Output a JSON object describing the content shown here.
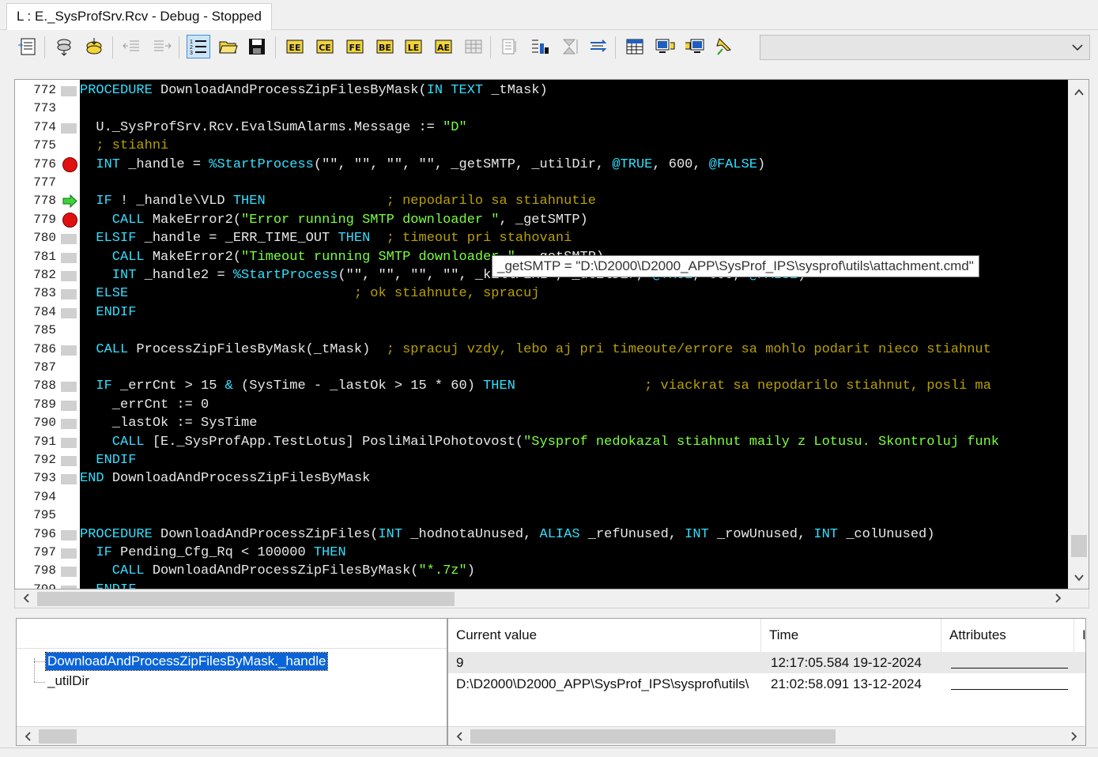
{
  "window": {
    "tab_title": "L : E._SysProfSrv.Rcv - Debug - Stopped"
  },
  "toolbar": {
    "buttons": [
      {
        "icon": "list-window-icon"
      },
      {
        "icon": "save-stack-icon"
      },
      {
        "icon": "load-stack-icon"
      },
      {
        "icon": "indent-left-icon"
      },
      {
        "icon": "indent-right-icon"
      },
      {
        "icon": "numbered-list-icon"
      },
      {
        "icon": "open-folder-icon"
      },
      {
        "icon": "save-disk-icon"
      },
      {
        "icon": "ee-icon"
      },
      {
        "icon": "ce-icon"
      },
      {
        "icon": "fe-icon"
      },
      {
        "icon": "be-icon"
      },
      {
        "icon": "le-icon"
      },
      {
        "icon": "ae-icon"
      },
      {
        "icon": "grid-disabled-icon"
      },
      {
        "icon": "step-over-icon"
      },
      {
        "icon": "step-into-icon"
      },
      {
        "icon": "sort-icon"
      },
      {
        "icon": "wrap-icon"
      },
      {
        "icon": "calendar-icon"
      },
      {
        "icon": "monitor-export-icon"
      },
      {
        "icon": "monitor-import-icon"
      },
      {
        "icon": "pin-icon"
      }
    ],
    "combo_value": ""
  },
  "editor": {
    "lines": [
      {
        "num": "772",
        "marker": "gray",
        "segs": [
          [
            "k",
            "PROCEDURE "
          ],
          [
            "n",
            "DownloadAndProcessZipFilesByMask("
          ],
          [
            "k",
            "IN "
          ],
          [
            "k",
            "TEXT "
          ],
          [
            "n",
            "_tMask)"
          ]
        ]
      },
      {
        "num": "773",
        "marker": "none",
        "segs": []
      },
      {
        "num": "774",
        "marker": "gray",
        "segs": [
          [
            "n",
            "  U._SysProfSrv.Rcv.EvalSumAlarms.Message := "
          ],
          [
            "s",
            "\"D\""
          ]
        ]
      },
      {
        "num": "775",
        "marker": "none",
        "segs": [
          [
            "c",
            "  ; stiahni"
          ]
        ]
      },
      {
        "num": "776",
        "marker": "breakpoint",
        "segs": [
          [
            "k",
            "  INT "
          ],
          [
            "n",
            "_handle = "
          ],
          [
            "k",
            "%StartProcess"
          ],
          [
            "n",
            "(\"\", \"\", \"\", \"\", _getSMTP, _utilDir, "
          ],
          [
            "k",
            "@TRUE"
          ],
          [
            "n",
            ", 600, "
          ],
          [
            "k",
            "@FALSE"
          ],
          [
            "n",
            ")"
          ]
        ]
      },
      {
        "num": "777",
        "marker": "none",
        "segs": []
      },
      {
        "num": "778",
        "marker": "arrow",
        "segs": [
          [
            "k",
            "  IF "
          ],
          [
            "n",
            "! _handle\\VLD "
          ],
          [
            "k",
            "THEN"
          ],
          [
            "n",
            "               "
          ],
          [
            "c",
            "; nepodarilo sa stiahnutie"
          ]
        ]
      },
      {
        "num": "779",
        "marker": "breakpoint",
        "segs": [
          [
            "k",
            "    CALL "
          ],
          [
            "n",
            "MakeError2("
          ],
          [
            "s",
            "\"Error running SMTP downloader \""
          ],
          [
            "n",
            ", _getSMTP)"
          ]
        ]
      },
      {
        "num": "780",
        "marker": "gray",
        "segs": [
          [
            "k",
            "  ELSIF "
          ],
          [
            "n",
            "_handle = _ERR_TIME_OUT "
          ],
          [
            "k",
            "THEN"
          ],
          [
            "n",
            "  "
          ],
          [
            "c",
            "; timeout pri stahovani"
          ]
        ]
      },
      {
        "num": "781",
        "marker": "gray",
        "segs": [
          [
            "k",
            "    CALL "
          ],
          [
            "n",
            "MakeError2("
          ],
          [
            "s",
            "\"Timeout running SMTP downloader \""
          ],
          [
            "n",
            ", _getSMTP)"
          ]
        ]
      },
      {
        "num": "782",
        "marker": "gray",
        "segs": [
          [
            "k",
            "    INT "
          ],
          [
            "n",
            "_handle2 = "
          ],
          [
            "k",
            "%StartProcess"
          ],
          [
            "n",
            "(\"\", \"\", \"\", \"\", _killPERL , _utilDir, "
          ],
          [
            "k",
            "@TRUE"
          ],
          [
            "n",
            ", 600, "
          ],
          [
            "k",
            "@FALSE"
          ],
          [
            "n",
            ")"
          ]
        ]
      },
      {
        "num": "783",
        "marker": "gray",
        "segs": [
          [
            "k",
            "  ELSE"
          ],
          [
            "n",
            "                            "
          ],
          [
            "c",
            "; ok stiahnute, spracuj"
          ]
        ]
      },
      {
        "num": "784",
        "marker": "gray",
        "segs": [
          [
            "k",
            "  ENDIF"
          ]
        ]
      },
      {
        "num": "785",
        "marker": "none",
        "segs": []
      },
      {
        "num": "786",
        "marker": "gray",
        "segs": [
          [
            "k",
            "  CALL "
          ],
          [
            "n",
            "ProcessZipFilesByMask(_tMask)  "
          ],
          [
            "c",
            "; spracuj vzdy, lebo aj pri timeoute/errore sa mohlo podarit nieco stiahnut"
          ]
        ]
      },
      {
        "num": "787",
        "marker": "none",
        "segs": []
      },
      {
        "num": "788",
        "marker": "gray",
        "segs": [
          [
            "k",
            "  IF "
          ],
          [
            "n",
            "_errCnt > 15 "
          ],
          [
            "k",
            "& "
          ],
          [
            "n",
            "(SysTime - _lastOk > 15 * 60) "
          ],
          [
            "k",
            "THEN"
          ],
          [
            "n",
            "                "
          ],
          [
            "c",
            "; viackrat sa nepodarilo stiahnut, posli ma"
          ]
        ]
      },
      {
        "num": "789",
        "marker": "gray",
        "segs": [
          [
            "n",
            "    _errCnt := 0"
          ]
        ]
      },
      {
        "num": "790",
        "marker": "gray",
        "segs": [
          [
            "n",
            "    _lastOk := SysTime"
          ]
        ]
      },
      {
        "num": "791",
        "marker": "gray",
        "segs": [
          [
            "k",
            "    CALL "
          ],
          [
            "n",
            "[E._SysProfApp.TestLotus] PosliMailPohotovost("
          ],
          [
            "s",
            "\"Sysprof nedokazal stiahnut maily z Lotusu. Skontroluj funk"
          ]
        ]
      },
      {
        "num": "792",
        "marker": "gray",
        "segs": [
          [
            "k",
            "  ENDIF"
          ]
        ]
      },
      {
        "num": "793",
        "marker": "gray",
        "segs": [
          [
            "k",
            "END "
          ],
          [
            "n",
            "DownloadAndProcessZipFilesByMask"
          ]
        ]
      },
      {
        "num": "794",
        "marker": "none",
        "segs": []
      },
      {
        "num": "795",
        "marker": "none",
        "segs": []
      },
      {
        "num": "796",
        "marker": "gray",
        "segs": [
          [
            "k",
            "PROCEDURE "
          ],
          [
            "n",
            "DownloadAndProcessZipFiles("
          ],
          [
            "k",
            "INT "
          ],
          [
            "n",
            "_hodnotaUnused, "
          ],
          [
            "k",
            "ALIAS "
          ],
          [
            "n",
            "_refUnused, "
          ],
          [
            "k",
            "INT "
          ],
          [
            "n",
            "_rowUnused, "
          ],
          [
            "k",
            "INT "
          ],
          [
            "n",
            "_colUnused)"
          ]
        ]
      },
      {
        "num": "797",
        "marker": "gray",
        "segs": [
          [
            "k",
            "  IF "
          ],
          [
            "n",
            "Pending_Cfg_Rq < 100000 "
          ],
          [
            "k",
            "THEN"
          ]
        ]
      },
      {
        "num": "798",
        "marker": "gray",
        "segs": [
          [
            "k",
            "    CALL "
          ],
          [
            "n",
            "DownloadAndProcessZipFilesByMask("
          ],
          [
            "s",
            "\"*.7z\""
          ],
          [
            "n",
            ")"
          ]
        ]
      },
      {
        "num": "799",
        "marker": "gray",
        "segs": [
          [
            "k",
            "  ENDIF"
          ]
        ]
      }
    ],
    "tooltip": "_getSMTP = \"D:\\D2000\\D2000_APP\\SysProf_IPS\\sysprof\\utils\\attachment.cmd\""
  },
  "watch": {
    "tree": [
      {
        "label": "DownloadAndProcessZipFilesByMask._handle",
        "selected": true
      },
      {
        "label": "_utilDir",
        "selected": false
      }
    ],
    "columns": [
      "Current value",
      "Time",
      "Attributes",
      "I"
    ],
    "rows": [
      {
        "value": "9",
        "time": "12:17:05.584 19-12-2024"
      },
      {
        "value": "D:\\D2000\\D2000_APP\\SysProf_IPS\\sysprof\\utils\\",
        "time": "21:02:58.091 13-12-2024"
      }
    ]
  },
  "colors": {
    "keyword": "#30e0ff",
    "string": "#7cff3c",
    "comment": "#b8a000",
    "breakpoint": "#e01010",
    "selection": "#0a64d8"
  }
}
